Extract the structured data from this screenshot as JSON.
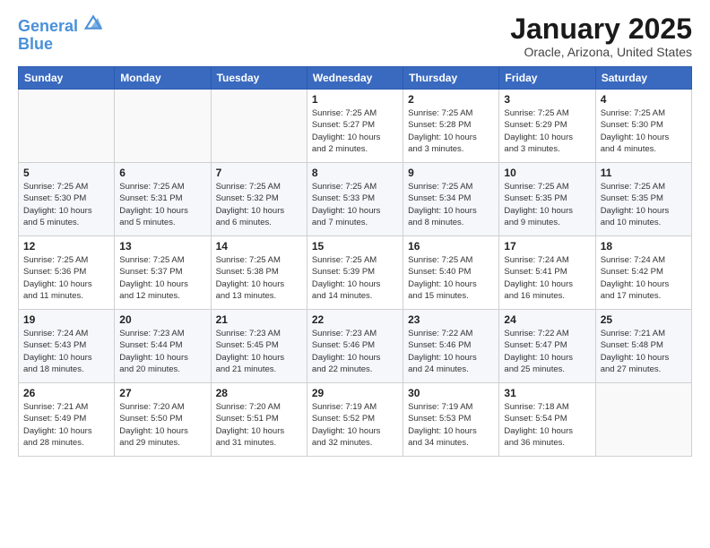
{
  "header": {
    "logo_line1": "General",
    "logo_line2": "Blue",
    "month_title": "January 2025",
    "location": "Oracle, Arizona, United States"
  },
  "weekdays": [
    "Sunday",
    "Monday",
    "Tuesday",
    "Wednesday",
    "Thursday",
    "Friday",
    "Saturday"
  ],
  "weeks": [
    [
      {
        "day": "",
        "info": ""
      },
      {
        "day": "",
        "info": ""
      },
      {
        "day": "",
        "info": ""
      },
      {
        "day": "1",
        "info": "Sunrise: 7:25 AM\nSunset: 5:27 PM\nDaylight: 10 hours\nand 2 minutes."
      },
      {
        "day": "2",
        "info": "Sunrise: 7:25 AM\nSunset: 5:28 PM\nDaylight: 10 hours\nand 3 minutes."
      },
      {
        "day": "3",
        "info": "Sunrise: 7:25 AM\nSunset: 5:29 PM\nDaylight: 10 hours\nand 3 minutes."
      },
      {
        "day": "4",
        "info": "Sunrise: 7:25 AM\nSunset: 5:30 PM\nDaylight: 10 hours\nand 4 minutes."
      }
    ],
    [
      {
        "day": "5",
        "info": "Sunrise: 7:25 AM\nSunset: 5:30 PM\nDaylight: 10 hours\nand 5 minutes."
      },
      {
        "day": "6",
        "info": "Sunrise: 7:25 AM\nSunset: 5:31 PM\nDaylight: 10 hours\nand 5 minutes."
      },
      {
        "day": "7",
        "info": "Sunrise: 7:25 AM\nSunset: 5:32 PM\nDaylight: 10 hours\nand 6 minutes."
      },
      {
        "day": "8",
        "info": "Sunrise: 7:25 AM\nSunset: 5:33 PM\nDaylight: 10 hours\nand 7 minutes."
      },
      {
        "day": "9",
        "info": "Sunrise: 7:25 AM\nSunset: 5:34 PM\nDaylight: 10 hours\nand 8 minutes."
      },
      {
        "day": "10",
        "info": "Sunrise: 7:25 AM\nSunset: 5:35 PM\nDaylight: 10 hours\nand 9 minutes."
      },
      {
        "day": "11",
        "info": "Sunrise: 7:25 AM\nSunset: 5:35 PM\nDaylight: 10 hours\nand 10 minutes."
      }
    ],
    [
      {
        "day": "12",
        "info": "Sunrise: 7:25 AM\nSunset: 5:36 PM\nDaylight: 10 hours\nand 11 minutes."
      },
      {
        "day": "13",
        "info": "Sunrise: 7:25 AM\nSunset: 5:37 PM\nDaylight: 10 hours\nand 12 minutes."
      },
      {
        "day": "14",
        "info": "Sunrise: 7:25 AM\nSunset: 5:38 PM\nDaylight: 10 hours\nand 13 minutes."
      },
      {
        "day": "15",
        "info": "Sunrise: 7:25 AM\nSunset: 5:39 PM\nDaylight: 10 hours\nand 14 minutes."
      },
      {
        "day": "16",
        "info": "Sunrise: 7:25 AM\nSunset: 5:40 PM\nDaylight: 10 hours\nand 15 minutes."
      },
      {
        "day": "17",
        "info": "Sunrise: 7:24 AM\nSunset: 5:41 PM\nDaylight: 10 hours\nand 16 minutes."
      },
      {
        "day": "18",
        "info": "Sunrise: 7:24 AM\nSunset: 5:42 PM\nDaylight: 10 hours\nand 17 minutes."
      }
    ],
    [
      {
        "day": "19",
        "info": "Sunrise: 7:24 AM\nSunset: 5:43 PM\nDaylight: 10 hours\nand 18 minutes."
      },
      {
        "day": "20",
        "info": "Sunrise: 7:23 AM\nSunset: 5:44 PM\nDaylight: 10 hours\nand 20 minutes."
      },
      {
        "day": "21",
        "info": "Sunrise: 7:23 AM\nSunset: 5:45 PM\nDaylight: 10 hours\nand 21 minutes."
      },
      {
        "day": "22",
        "info": "Sunrise: 7:23 AM\nSunset: 5:46 PM\nDaylight: 10 hours\nand 22 minutes."
      },
      {
        "day": "23",
        "info": "Sunrise: 7:22 AM\nSunset: 5:46 PM\nDaylight: 10 hours\nand 24 minutes."
      },
      {
        "day": "24",
        "info": "Sunrise: 7:22 AM\nSunset: 5:47 PM\nDaylight: 10 hours\nand 25 minutes."
      },
      {
        "day": "25",
        "info": "Sunrise: 7:21 AM\nSunset: 5:48 PM\nDaylight: 10 hours\nand 27 minutes."
      }
    ],
    [
      {
        "day": "26",
        "info": "Sunrise: 7:21 AM\nSunset: 5:49 PM\nDaylight: 10 hours\nand 28 minutes."
      },
      {
        "day": "27",
        "info": "Sunrise: 7:20 AM\nSunset: 5:50 PM\nDaylight: 10 hours\nand 29 minutes."
      },
      {
        "day": "28",
        "info": "Sunrise: 7:20 AM\nSunset: 5:51 PM\nDaylight: 10 hours\nand 31 minutes."
      },
      {
        "day": "29",
        "info": "Sunrise: 7:19 AM\nSunset: 5:52 PM\nDaylight: 10 hours\nand 32 minutes."
      },
      {
        "day": "30",
        "info": "Sunrise: 7:19 AM\nSunset: 5:53 PM\nDaylight: 10 hours\nand 34 minutes."
      },
      {
        "day": "31",
        "info": "Sunrise: 7:18 AM\nSunset: 5:54 PM\nDaylight: 10 hours\nand 36 minutes."
      },
      {
        "day": "",
        "info": ""
      }
    ]
  ]
}
